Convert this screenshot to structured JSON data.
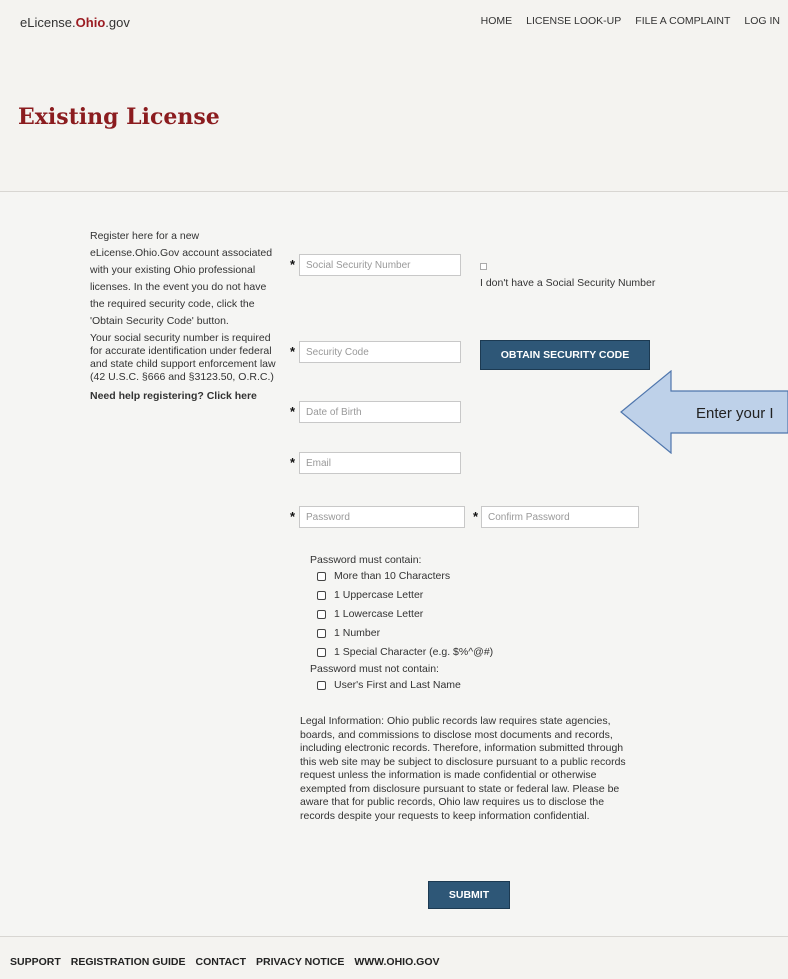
{
  "header": {
    "logo_prefix": "eLicense.",
    "logo_ohio": "Ohio",
    "logo_suffix": ".gov",
    "nav": [
      "HOME",
      "LICENSE LOOK-UP",
      "FILE A COMPLAINT",
      "LOG IN"
    ],
    "page_title": "Existing License"
  },
  "sidebar": {
    "intro": "Register here for a new eLicense.Ohio.Gov account associated with your existing Ohio professional licenses. In the event you do not have the required security code, click the 'Obtain Security Code' button.",
    "ssn_note": "Your social security number is required for accurate identification under federal and state child support enforcement law (42 U.S.C. §666 and §3123.50, O.R.C.)",
    "help_link": "Need help registering? Click here"
  },
  "form": {
    "required_mark": "*",
    "ssn_placeholder": "Social Security Number",
    "no_ssn_label": "I don't have a Social Security Number",
    "security_code_placeholder": "Security Code",
    "obtain_code_button": "OBTAIN SECURITY CODE",
    "dob_placeholder": "Date of Birth",
    "email_placeholder": "Email",
    "password_placeholder": "Password",
    "confirm_password_placeholder": "Confirm Password",
    "submit_button": "SUBMIT"
  },
  "callout": {
    "text": "Enter your I",
    "fill": "#bed1e9",
    "stroke": "#4f76ad"
  },
  "password_rules": {
    "must_contain_title": "Password must contain:",
    "must_contain": [
      "More than 10 Characters",
      "1 Uppercase Letter",
      "1 Lowercase Letter",
      "1 Number",
      "1 Special Character (e.g. $%^@#)"
    ],
    "must_not_contain_title": "Password must not contain:",
    "must_not_contain": [
      "User's First and Last Name"
    ]
  },
  "legal": "Legal Information: Ohio public records law requires state agencies, boards, and commissions to disclose most documents and records, including electronic records. Therefore, information submitted through this web site may be subject to disclosure pursuant to a public records request unless the information is made confidential or otherwise exempted from disclosure pursuant to state or federal law. Please be aware that for public records, Ohio law requires us to disclose the records despite your requests to keep information confidential.",
  "footer": {
    "links": [
      "SUPPORT",
      "REGISTRATION GUIDE",
      "CONTACT",
      "PRIVACY NOTICE",
      "WWW.OHIO.GOV"
    ]
  },
  "colors": {
    "brand_red": "#9b1c22",
    "button_blue": "#2e5777"
  }
}
